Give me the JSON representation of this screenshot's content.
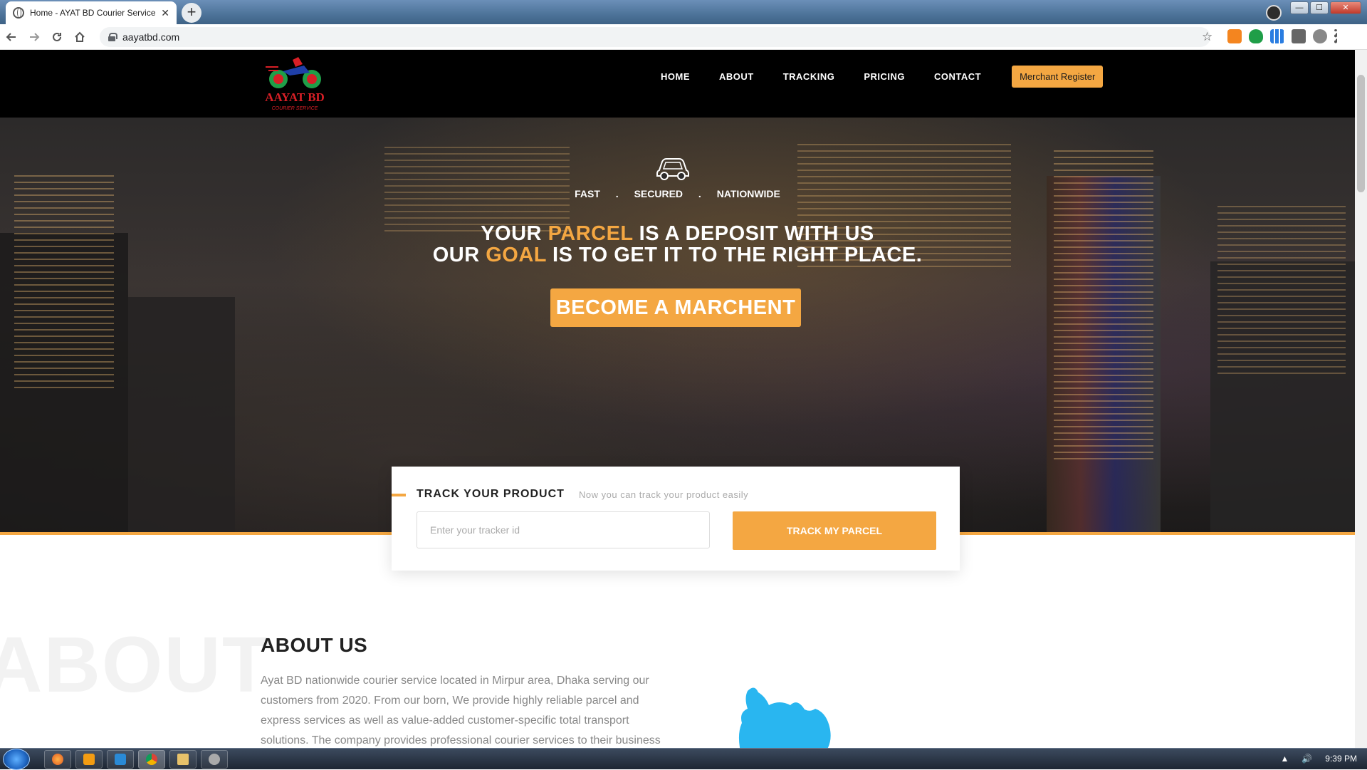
{
  "browser": {
    "tab_title": "Home - AYAT BD Courier Service",
    "tab_close": "✕",
    "new_tab": "+",
    "url": "aayatbd.com",
    "window_controls": {
      "minimize": "—",
      "maximize": "☐",
      "close": "✕"
    }
  },
  "site": {
    "logo_text": "AAYAT BD",
    "logo_sub": "COURIER SERVICE",
    "nav": [
      {
        "label": "HOME"
      },
      {
        "label": "ABOUT"
      },
      {
        "label": "TRACKING"
      },
      {
        "label": "PRICING"
      },
      {
        "label": "CONTACT"
      }
    ],
    "merchant_register": "Merchant Register"
  },
  "hero": {
    "taglines": [
      "FAST",
      ".",
      "SECURED",
      ".",
      "NATIONWIDE"
    ],
    "headline_line1": {
      "a": "YOUR ",
      "b": "PARCEL",
      "c": " IS A DEPOSIT WITH US"
    },
    "headline_line2": {
      "a": "OUR ",
      "b": "GOAL",
      "c": " IS TO GET IT TO THE RIGHT PLACE."
    },
    "cta": "BECOME A MARCHENT"
  },
  "track": {
    "title": "TRACK YOUR PRODUCT",
    "subtitle": "Now you can track your product easily",
    "placeholder": "Enter your tracker id",
    "value": "",
    "button": "TRACK MY PARCEL"
  },
  "about": {
    "background_word": "ABOUT",
    "title": "ABOUT US",
    "text": "Ayat BD nationwide courier service located in Mirpur area, Dhaka serving our customers from 2020. From our born, We provide highly reliable parcel and express services as well as value-added customer-specific total transport solutions. The company provides professional courier services to their business"
  },
  "taskbar": {
    "time": "9:39 PM",
    "tray_arrow": "▲",
    "volume": "🔊"
  },
  "colors": {
    "accent": "#f4a742",
    "header_bg": "#000000",
    "map_blue": "#29b6f0"
  }
}
